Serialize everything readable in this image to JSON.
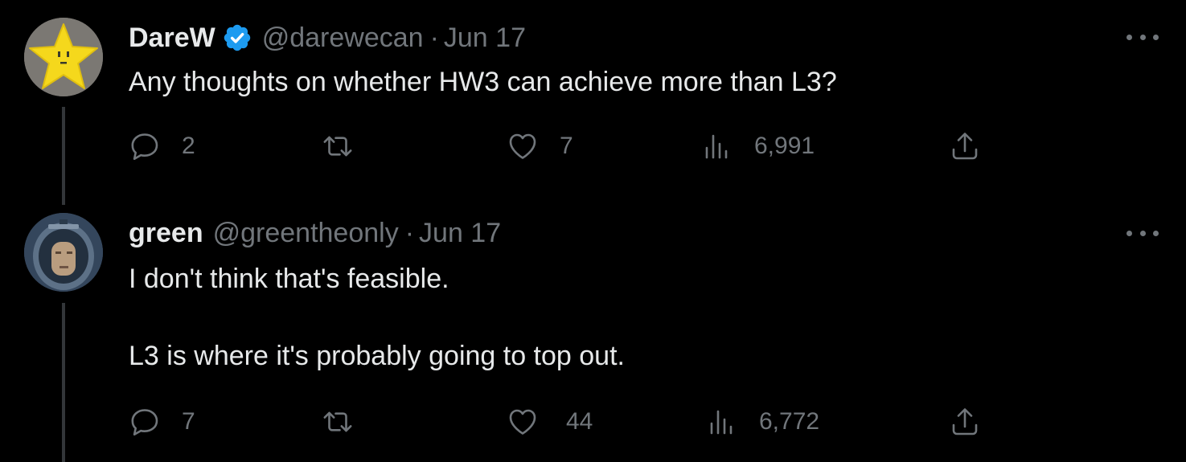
{
  "tweets": [
    {
      "display_name": "DareW",
      "verified": true,
      "handle": "@darewecan",
      "separator": "·",
      "date": "Jun 17",
      "text": "Any thoughts on whether HW3 can achieve more than L3?",
      "avatar_icon": "star-face-avatar",
      "stats": {
        "replies": "2",
        "retweets": "",
        "likes": "7",
        "views": "6,991"
      }
    },
    {
      "display_name": "green",
      "verified": false,
      "handle": "@greentheonly",
      "separator": "·",
      "date": "Jun 17",
      "text": "I don't think that's feasible.\n\nL3 is where it's probably going to top out.",
      "avatar_icon": "astronaut-avatar",
      "stats": {
        "replies": "7",
        "retweets": "",
        "likes": "44",
        "views": "6,772"
      }
    }
  ],
  "colors": {
    "background": "#000000",
    "primary_text": "#e7e9ea",
    "secondary_text": "#71767b",
    "verified_badge": "#1d9bf0",
    "thread_line": "#333639"
  }
}
